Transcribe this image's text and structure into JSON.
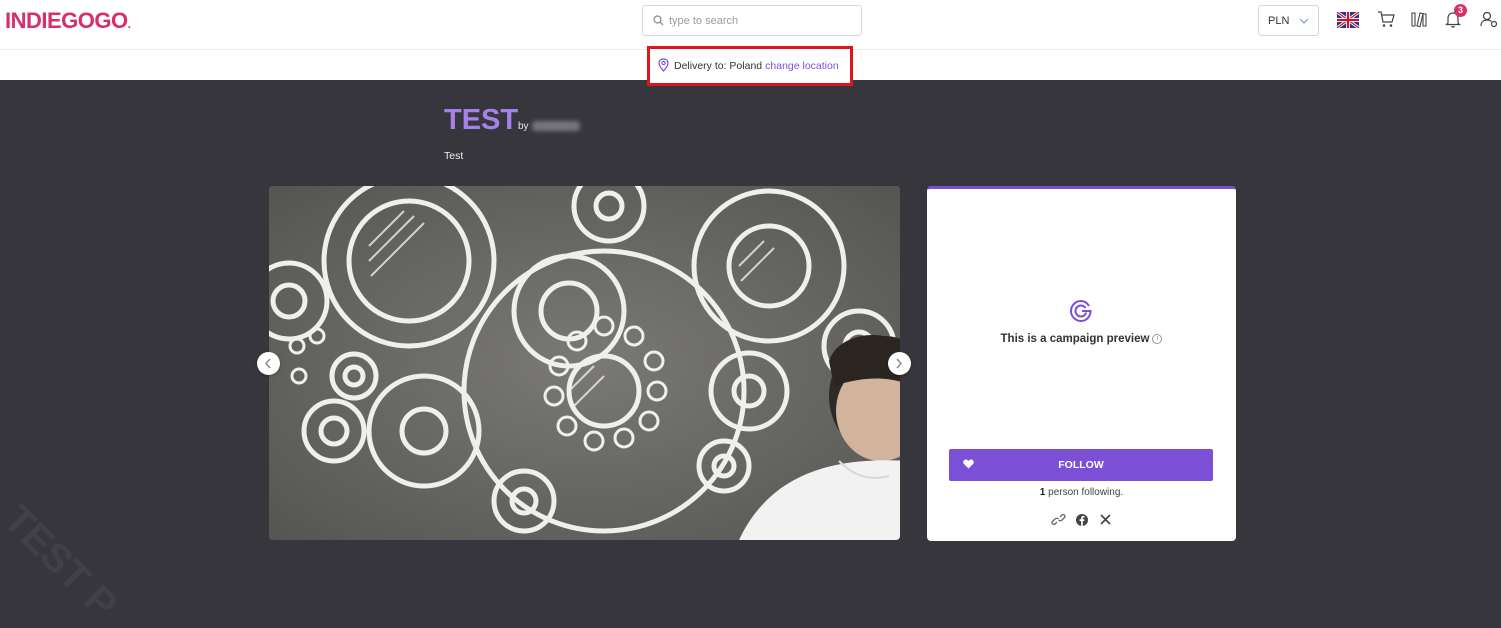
{
  "header": {
    "logo": "INDIEGOGO",
    "logo_dot": ".",
    "search_placeholder": "type to search",
    "currency": "PLN",
    "notifications_count": "3"
  },
  "delivery": {
    "label": "Delivery to: Poland",
    "link": "change location"
  },
  "campaign": {
    "title": "TEST",
    "by": "by",
    "tagline": "Test",
    "watermark": "TEST P"
  },
  "card": {
    "preview_text": "This is a campaign preview",
    "info_glyph": "i",
    "follow_label": "FOLLOW",
    "following_count": "1",
    "following_text": " person following."
  },
  "colors": {
    "brand": "#d72f6c",
    "accent": "#7b4fd6",
    "hero_bg": "#38363d",
    "highlight": "#e0141d"
  },
  "icons": [
    "search-icon",
    "chevron-down-icon",
    "uk-flag-icon",
    "cart-icon",
    "bookshelf-icon",
    "bell-icon",
    "user-settings-icon",
    "location-pin-icon",
    "chevron-left-icon",
    "chevron-right-icon",
    "indiegogo-g-icon",
    "info-icon",
    "heart-icon",
    "link-icon",
    "facebook-icon",
    "x-icon"
  ]
}
